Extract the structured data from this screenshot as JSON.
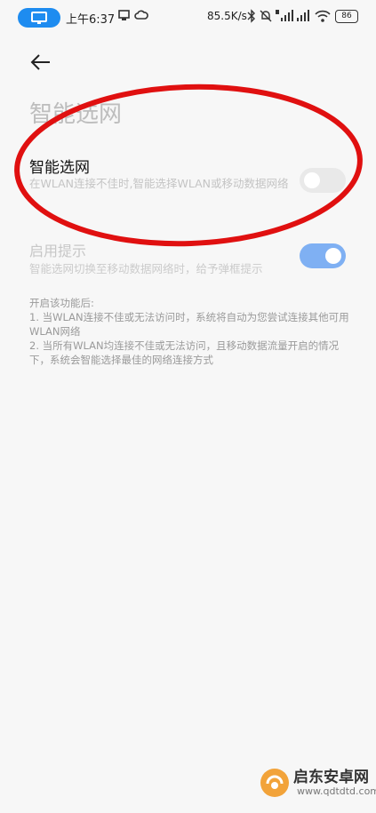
{
  "status_bar": {
    "time": "上午6:37",
    "net_speed": "85.5K/s",
    "battery": "86",
    "accent_color": "#1e8cf0"
  },
  "header": {
    "back_icon": "arrow-left-icon",
    "title": "智能选网"
  },
  "settings": {
    "smart_network": {
      "title": "智能选网",
      "description": "在WLAN连接不佳时,智能选择WLAN或移动数据网络",
      "enabled": false
    },
    "enable_prompt": {
      "title": "启用提示",
      "description": "智能选网切换至移动数据网络时，给予弹框提示",
      "enabled": true,
      "on_color": "#7fb0f3"
    }
  },
  "notes": {
    "heading": "开启该功能后:",
    "item1": "1. 当WLAN连接不佳或无法访问时，系统将自动为您尝试连接其他可用WLAN网络",
    "item2": "2. 当所有WLAN均连接不佳或无法访问，且移动数据流量开启的情况下，系统会智能选择最佳的网络连接方式"
  },
  "annotation": {
    "color": "#e01010",
    "shape": "ellipse"
  },
  "watermark": {
    "name": "启东安卓网",
    "url": "www.qdtdtd.com"
  }
}
